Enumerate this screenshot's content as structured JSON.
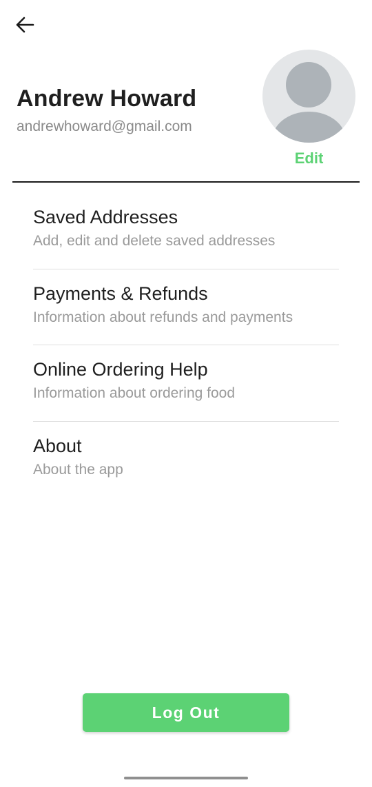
{
  "profile": {
    "name": "Andrew Howard",
    "email": "andrewhoward@gmail.com",
    "edit_label": "Edit"
  },
  "menu": {
    "items": [
      {
        "title": "Saved Addresses",
        "subtitle": "Add, edit and delete saved addresses"
      },
      {
        "title": "Payments & Refunds",
        "subtitle": "Information about refunds and payments"
      },
      {
        "title": "Online Ordering Help",
        "subtitle": "Information about ordering food"
      },
      {
        "title": "About",
        "subtitle": "About the app"
      }
    ]
  },
  "logout": {
    "label": "Log Out"
  },
  "icons": {
    "back": "arrow-left-icon",
    "avatar": "user-placeholder-icon"
  },
  "colors": {
    "accent": "#5cd274",
    "title_text": "#1f1f1f",
    "secondary_text": "#8a8a8a",
    "avatar_bg": "#e4e6e8",
    "avatar_fg": "#adb3b8"
  }
}
